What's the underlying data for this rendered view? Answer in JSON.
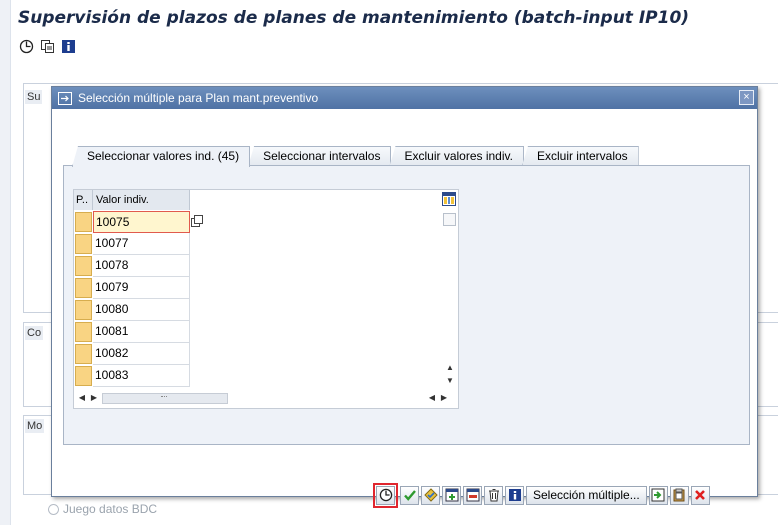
{
  "app": {
    "title": "Supervisión de plazos de planes de mantenimiento (batch-input IP10)",
    "toolbar": [
      "execute-icon",
      "copy-icon",
      "info-icon"
    ]
  },
  "background": {
    "frame_labels": [
      "Su",
      "Co",
      "Mo"
    ],
    "bottom_radio_label": "Juego datos BDC"
  },
  "dialog": {
    "title": "Selección múltiple para Plan mant.preventivo",
    "close_label": "×",
    "tabs": [
      {
        "label": "Seleccionar valores ind. (45)",
        "active": true
      },
      {
        "label": "Seleccionar intervalos",
        "active": false
      },
      {
        "label": "Excluir valores indiv.",
        "active": false
      },
      {
        "label": "Excluir intervalos",
        "active": false
      }
    ],
    "table": {
      "sel_header": "P..",
      "col_header": "Valor indiv.",
      "rows": [
        "10075",
        "10077",
        "10078",
        "10079",
        "10080",
        "10081",
        "10082",
        "10083"
      ]
    },
    "footer": {
      "multi_select_label": "Selección múltiple...",
      "icons": [
        "execute-icon",
        "check-icon",
        "check-entries-icon",
        "insert-line-icon",
        "delete-line-icon",
        "delete-all-icon",
        "info-icon",
        "import-icon",
        "clipboard-icon",
        "cancel-icon"
      ]
    }
  },
  "colors": {
    "title_text": "#1b2b4a",
    "dialog_titlebar": "#5478aa",
    "row_selector": "#f9d483",
    "highlight_border": "#e0262e",
    "cancel_red": "#e02020",
    "check_green": "#2f9a2f"
  }
}
